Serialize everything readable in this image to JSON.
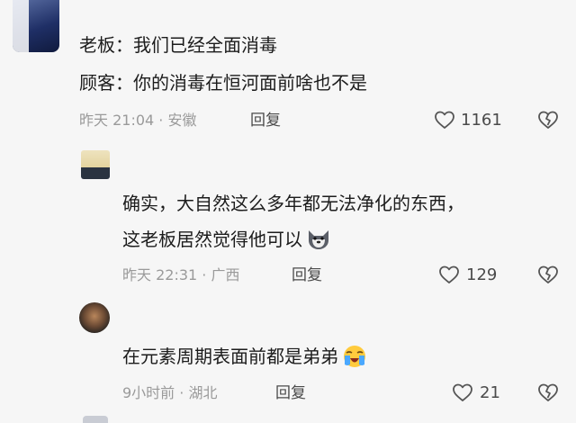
{
  "comments": [
    {
      "lines": [
        "老板：我们已经全面消毒",
        "顾客：你的消毒在恒河面前啥也不是"
      ],
      "meta": "昨天 21:04 · 安徽",
      "reply_label": "回复",
      "like_count": "1161"
    },
    {
      "lines": [
        "确实，大自然这么多年都无法净化的东西，",
        "这老板居然觉得他可以"
      ],
      "emoji": "dog-face",
      "meta": "昨天 22:31 · 广西",
      "reply_label": "回复",
      "like_count": "129"
    },
    {
      "lines": [
        "在元素周期表面前都是弟弟"
      ],
      "emoji": "loudly-crying-face",
      "meta": "9小时前 · 湖北",
      "reply_label": "回复",
      "like_count": "21"
    }
  ],
  "colors": {
    "background": "#f6f6f6",
    "text": "#1c1c1c",
    "meta": "#9a9a9a"
  }
}
